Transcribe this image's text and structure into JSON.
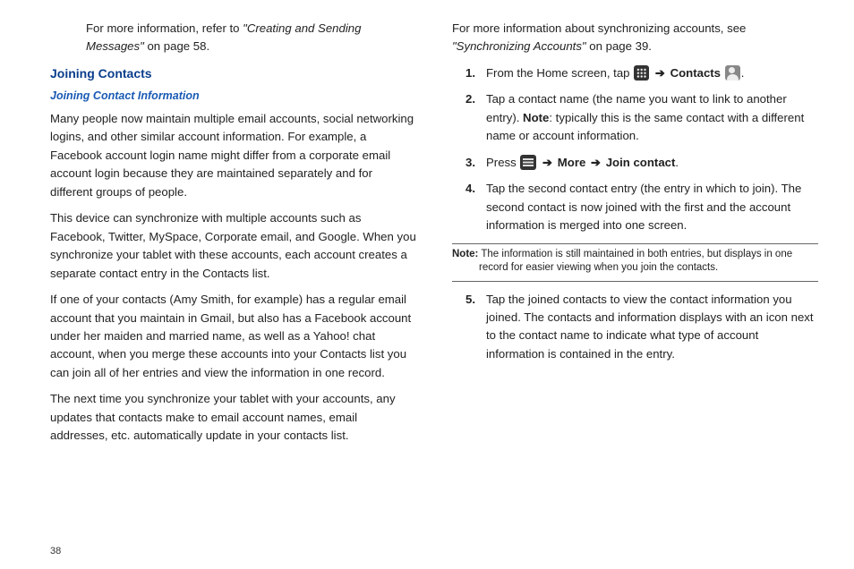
{
  "page_number": "38",
  "left": {
    "intro_prefix": "For more information, refer to ",
    "intro_ref": "\"Creating and Sending Messages\"",
    "intro_suffix": "  on page 58.",
    "h2": "Joining Contacts",
    "h3": "Joining Contact Information",
    "p1": "Many people now maintain multiple email accounts, social networking logins, and other similar account information. For example, a Facebook account login name might differ from a corporate email account login because they are maintained separately and for different groups of people.",
    "p2": "This device can synchronize with multiple accounts such as Facebook, Twitter, MySpace, Corporate email, and Google. When you synchronize your tablet with these accounts, each account creates a separate contact entry in the Contacts list.",
    "p3": "If one of your contacts (Amy Smith, for example) has a regular email account that you maintain in Gmail, but also has a Facebook account under her maiden and married name, as well as a Yahoo! chat account, when you merge these accounts into your Contacts list you can join all of her entries and view the information in one record.",
    "p4": "The next time you synchronize your tablet with your accounts, any updates that contacts make to email account names, email addresses, etc. automatically update in your contacts list."
  },
  "right": {
    "intro_prefix": "For more information about synchronizing accounts, see ",
    "intro_ref": "\"Synchronizing Accounts\"",
    "intro_suffix": " on page 39.",
    "steps": {
      "s1_num": "1.",
      "s1_a": "From the Home screen, tap ",
      "s1_contacts": "Contacts",
      "s1_end": ".",
      "s2_num": "2.",
      "s2_a": "Tap a contact name (the name you want to link to another entry). ",
      "s2_note_label": "Note",
      "s2_b": ": typically this is the same contact with a different name or account information.",
      "s3_num": "3.",
      "s3_a": "Press ",
      "s3_more": "More",
      "s3_join": "Join contact",
      "s3_end": ".",
      "s4_num": "4.",
      "s4": "Tap the second contact entry (the entry in which to join). The second contact is now joined with the first and the account information is merged into one screen.",
      "s5_num": "5.",
      "s5": "Tap the joined contacts to view the contact information you joined. The contacts and information displays with an icon next to the contact name to indicate what type of account information is contained in the entry."
    },
    "note_label": "Note:",
    "note_body": " The information is still maintained in both entries, but displays in one record for easier viewing when you join the contacts."
  },
  "arrow": "➔"
}
